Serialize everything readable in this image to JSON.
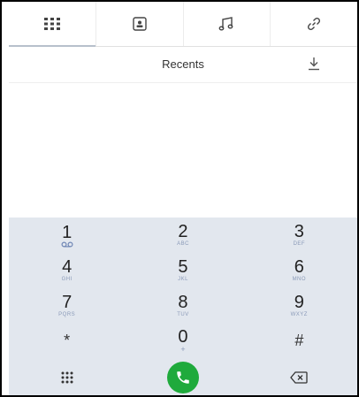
{
  "tabs": [
    {
      "name": "keypad-tab",
      "icon": "grid-icon"
    },
    {
      "name": "contacts-tab",
      "icon": "contact-card-icon"
    },
    {
      "name": "music-tab",
      "icon": "music-note-icon"
    },
    {
      "name": "links-tab",
      "icon": "link-icon"
    }
  ],
  "header": {
    "title": "Recents"
  },
  "keypad": {
    "keys": [
      {
        "digit": "1",
        "letters": "ᴏᴏ"
      },
      {
        "digit": "2",
        "letters": "ABC"
      },
      {
        "digit": "3",
        "letters": "DEF"
      },
      {
        "digit": "4",
        "letters": "GHI"
      },
      {
        "digit": "5",
        "letters": "JKL"
      },
      {
        "digit": "6",
        "letters": "MNO"
      },
      {
        "digit": "7",
        "letters": "PQRS"
      },
      {
        "digit": "8",
        "letters": "TUV"
      },
      {
        "digit": "9",
        "letters": "WXYZ"
      },
      {
        "digit": "*",
        "letters": ""
      },
      {
        "digit": "0",
        "letters": "+"
      },
      {
        "digit": "#",
        "letters": ""
      }
    ]
  },
  "colors": {
    "call": "#1faa3c",
    "keypad_bg": "#e2e7ee"
  }
}
